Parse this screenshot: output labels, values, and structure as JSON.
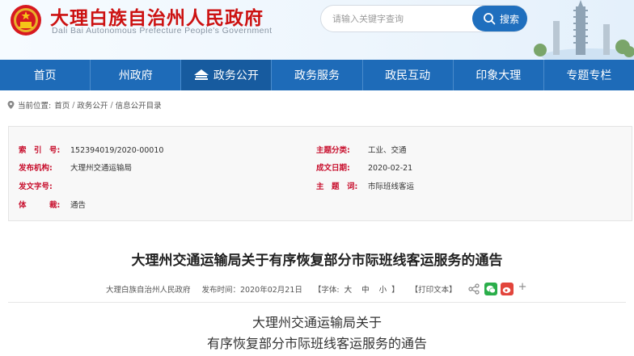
{
  "header": {
    "title": "大理白族自治州人民政府",
    "subtitle": "Dali Bai Autonomous Prefecture People's Government",
    "search_placeholder": "请输入关键字查询",
    "search_button": "搜索"
  },
  "nav": {
    "items": [
      {
        "label": "首页"
      },
      {
        "label": "州政府"
      },
      {
        "label": "政务公开"
      },
      {
        "label": "政务服务"
      },
      {
        "label": "政民互动"
      },
      {
        "label": "印象大理"
      },
      {
        "label": "专题专栏"
      }
    ]
  },
  "breadcrumb": {
    "prefix": "当前位置:",
    "items": [
      "首页",
      "政务公开",
      "信息公开目录"
    ],
    "sep": "/"
  },
  "info": {
    "index_key": "索　引　号:",
    "index_val": "152394019/2020-00010",
    "topic_key": "主题分类:",
    "topic_val": "工业、交通",
    "org_key": "发布机构:",
    "org_val": "大理州交通运输局",
    "date_key": "成文日期:",
    "date_val": "2020-02-21",
    "docno_key": "发文字号:",
    "docno_val": "",
    "subject_key": "主　题　词:",
    "subject_val": "市际班线客运",
    "genre_key": "体　　　裁:",
    "genre_val": "通告"
  },
  "article": {
    "title": "大理州交通运输局关于有序恢复部分市际班线客运服务的通告",
    "source": "大理白族自治州人民政府",
    "publish_time": "发布时间：2020年02月21日",
    "font_label": "【字体:",
    "font_large": "大",
    "font_medium": "中",
    "font_small": "小",
    "font_close": "】",
    "print": "【打印文本】",
    "plus": "+",
    "body_title_line1": "大理州交通运输局关于",
    "body_title_line2": "有序恢复部分市际班线客运服务的通告"
  },
  "colors": {
    "brand_red": "#cc1111",
    "nav_blue": "#1e6bb8",
    "key_red": "#c8102e"
  }
}
